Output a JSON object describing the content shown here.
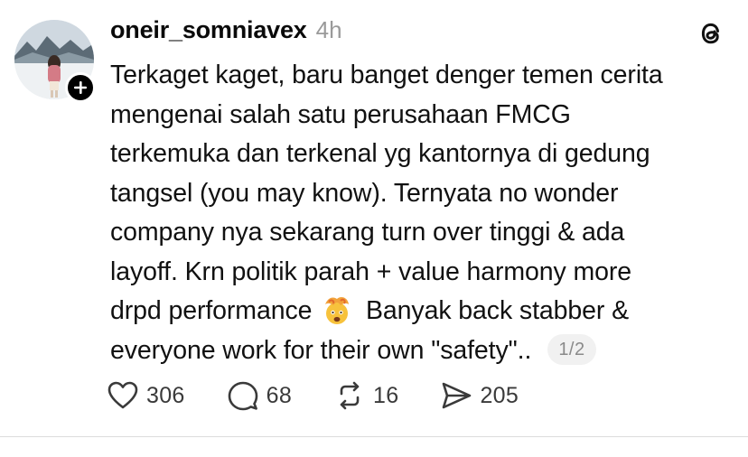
{
  "post": {
    "username": "oneir_somniavex",
    "timestamp": "4h",
    "text_before_emoji": "Terkaget kaget, baru banget denger temen cerita\nmengenai salah satu perusahaan FMCG\nterkemuka dan terkenal yg kantornya di gedung\ntangsel (you may know). Ternyata no wonder\ncompany nya sekarang turn over tinggi & ada\nlayoff. Krn politik parah + value harmony more\ndrpd performance",
    "text_after_emoji": "Banyak back stabber &\neveryone work for their own \"safety\"..",
    "emoji": "exploding-head-emoji",
    "page_indicator": "1/2"
  },
  "actions": {
    "likes": "306",
    "replies": "68",
    "reposts": "16",
    "shares": "205"
  },
  "icons": {
    "like": "heart-icon",
    "reply": "comment-icon",
    "repost": "repost-icon",
    "share": "send-icon",
    "app": "threads-logo-icon",
    "follow": "plus-icon"
  }
}
